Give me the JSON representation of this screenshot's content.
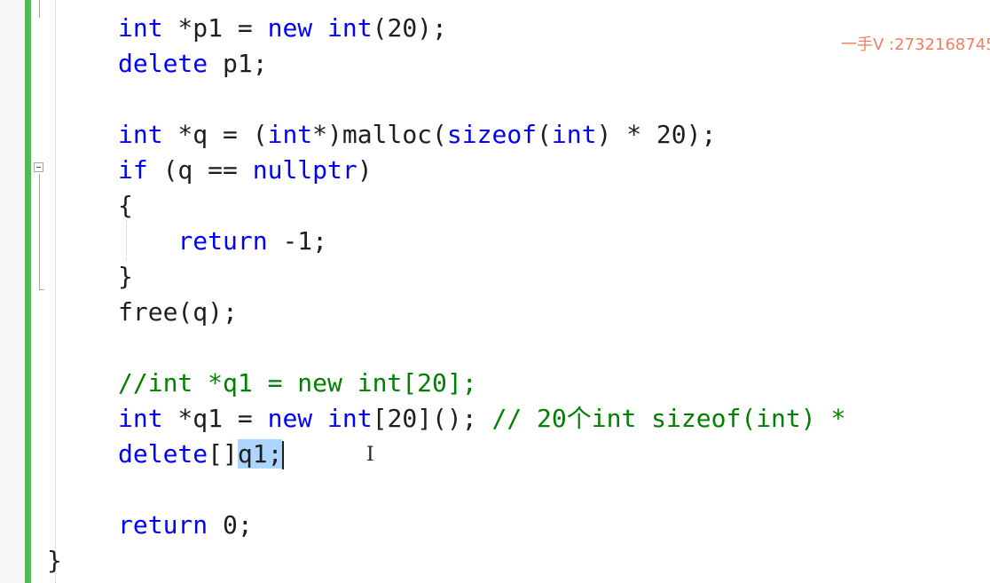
{
  "watermark": "一手V :2732168745",
  "editor": {
    "lines": [
      {
        "tokens": [
          {
            "t": "int",
            "c": "kw"
          },
          {
            "t": " *p1 = ",
            "c": "pl"
          },
          {
            "t": "new",
            "c": "kw"
          },
          {
            "t": " ",
            "c": "pl"
          },
          {
            "t": "int",
            "c": "kw"
          },
          {
            "t": "(20);",
            "c": "pl"
          }
        ]
      },
      {
        "tokens": [
          {
            "t": "delete",
            "c": "kw"
          },
          {
            "t": " p1;",
            "c": "pl"
          }
        ]
      },
      {
        "tokens": []
      },
      {
        "tokens": [
          {
            "t": "int",
            "c": "kw"
          },
          {
            "t": " *q = (",
            "c": "pl"
          },
          {
            "t": "int",
            "c": "kw"
          },
          {
            "t": "*)malloc(",
            "c": "pl"
          },
          {
            "t": "sizeof",
            "c": "kw"
          },
          {
            "t": "(",
            "c": "pl"
          },
          {
            "t": "int",
            "c": "kw"
          },
          {
            "t": ") * 20);",
            "c": "pl"
          }
        ]
      },
      {
        "tokens": [
          {
            "t": "if",
            "c": "kw"
          },
          {
            "t": " (q == ",
            "c": "pl"
          },
          {
            "t": "nullptr",
            "c": "kw"
          },
          {
            "t": ")",
            "c": "pl"
          }
        ]
      },
      {
        "tokens": [
          {
            "t": "{",
            "c": "pl"
          }
        ]
      },
      {
        "tokens": [
          {
            "t": "    ",
            "c": "pl"
          },
          {
            "t": "return",
            "c": "kw"
          },
          {
            "t": " -1;",
            "c": "pl"
          }
        ]
      },
      {
        "tokens": [
          {
            "t": "}",
            "c": "pl"
          }
        ]
      },
      {
        "tokens": [
          {
            "t": "free(q);",
            "c": "pl"
          }
        ]
      },
      {
        "tokens": []
      },
      {
        "tokens": [
          {
            "t": "//int *q1 = new int[20];",
            "c": "cm"
          }
        ]
      },
      {
        "tokens": [
          {
            "t": "int",
            "c": "kw"
          },
          {
            "t": " *q1 = ",
            "c": "pl"
          },
          {
            "t": "new",
            "c": "kw"
          },
          {
            "t": " ",
            "c": "pl"
          },
          {
            "t": "int",
            "c": "kw"
          },
          {
            "t": "[20](); ",
            "c": "pl"
          },
          {
            "t": "// 20个int sizeof(int) * ",
            "c": "cm"
          }
        ]
      },
      {
        "tokens": [
          {
            "t": "delete",
            "c": "kw"
          },
          {
            "t": "[]",
            "c": "pl"
          },
          {
            "t": "q1;",
            "c": "sel"
          }
        ]
      },
      {
        "tokens": []
      },
      {
        "tokens": [
          {
            "t": "return",
            "c": "kw"
          },
          {
            "t": " 0;",
            "c": "pl"
          }
        ]
      },
      {
        "tokens": [
          {
            "t": "}",
            "c": "pl"
          }
        ]
      }
    ]
  }
}
